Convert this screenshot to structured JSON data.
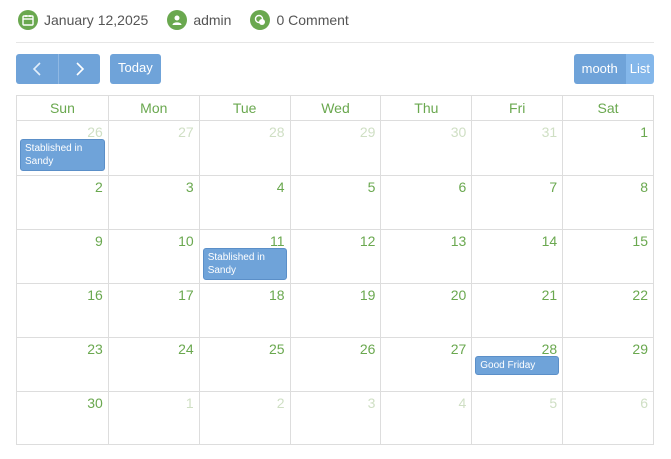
{
  "meta": {
    "date": "January 12,2025",
    "author": "admin",
    "comments": "0 Comment"
  },
  "toolbar": {
    "today_label": "Today",
    "views": [
      {
        "label": "mooth",
        "active": false
      },
      {
        "label": "List",
        "active": true
      }
    ]
  },
  "calendar": {
    "weekdays": [
      "Sun",
      "Mon",
      "Tue",
      "Wed",
      "Thu",
      "Fri",
      "Sat"
    ],
    "weeks": [
      [
        {
          "day": "26",
          "other": true,
          "event": "Stablished in Sandy"
        },
        {
          "day": "27",
          "other": true
        },
        {
          "day": "28",
          "other": true
        },
        {
          "day": "29",
          "other": true
        },
        {
          "day": "30",
          "other": true
        },
        {
          "day": "31",
          "other": true
        },
        {
          "day": "1"
        }
      ],
      [
        {
          "day": "2"
        },
        {
          "day": "3"
        },
        {
          "day": "4"
        },
        {
          "day": "5"
        },
        {
          "day": "6"
        },
        {
          "day": "7"
        },
        {
          "day": "8"
        }
      ],
      [
        {
          "day": "9"
        },
        {
          "day": "10"
        },
        {
          "day": "11",
          "event": "Stablished in Sandy"
        },
        {
          "day": "12"
        },
        {
          "day": "13"
        },
        {
          "day": "14"
        },
        {
          "day": "15"
        }
      ],
      [
        {
          "day": "16"
        },
        {
          "day": "17"
        },
        {
          "day": "18"
        },
        {
          "day": "19"
        },
        {
          "day": "20"
        },
        {
          "day": "21"
        },
        {
          "day": "22"
        }
      ],
      [
        {
          "day": "23"
        },
        {
          "day": "24"
        },
        {
          "day": "25"
        },
        {
          "day": "26"
        },
        {
          "day": "27"
        },
        {
          "day": "28",
          "event": "Good Friday"
        },
        {
          "day": "29"
        }
      ],
      [
        {
          "day": "30"
        },
        {
          "day": "1",
          "other": true
        },
        {
          "day": "2",
          "other": true
        },
        {
          "day": "3",
          "other": true
        },
        {
          "day": "4",
          "other": true
        },
        {
          "day": "5",
          "other": true
        },
        {
          "day": "6",
          "other": true
        }
      ]
    ]
  },
  "colors": {
    "accent_green": "#6aa84f",
    "button_blue": "#6fa3d9",
    "other_month_day": "#cfdfc4"
  },
  "icons": [
    "calendar-icon",
    "user-icon",
    "comment-icon",
    "chevron-left-icon",
    "chevron-right-icon"
  ]
}
